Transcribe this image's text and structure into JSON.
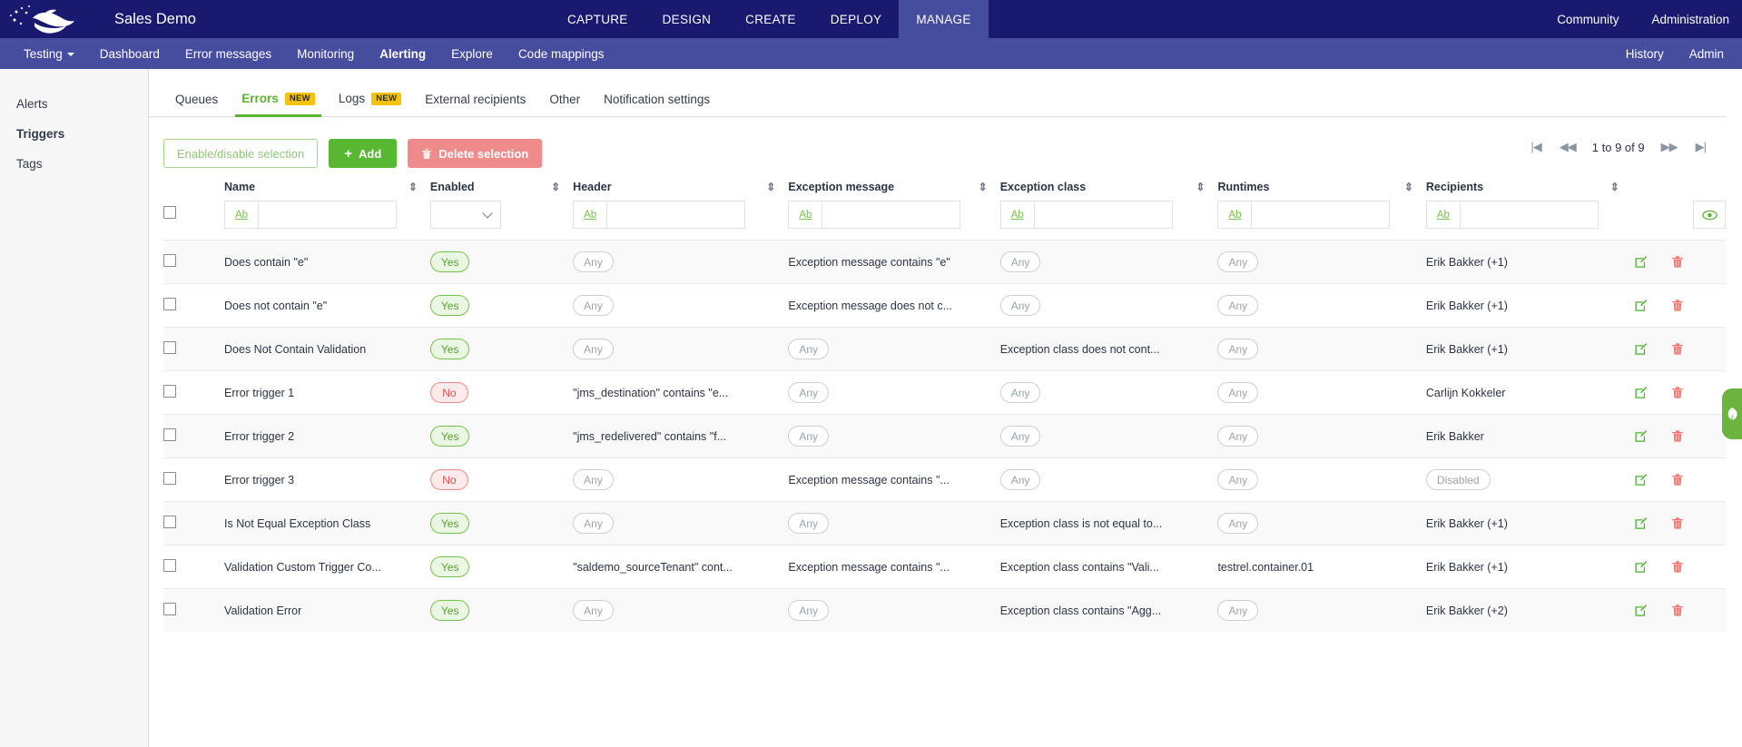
{
  "header": {
    "brand_title": "Sales Demo",
    "logo_icon": "whale-logo-icon",
    "center_nav": [
      {
        "label": "CAPTURE",
        "active": false
      },
      {
        "label": "DESIGN",
        "active": false
      },
      {
        "label": "CREATE",
        "active": false
      },
      {
        "label": "DEPLOY",
        "active": false
      },
      {
        "label": "MANAGE",
        "active": true
      }
    ],
    "right_nav": [
      {
        "label": "Community"
      },
      {
        "label": "Administration"
      }
    ],
    "accent_bg": "#191970",
    "active_tab_bg": "#464c9e"
  },
  "subnav": {
    "items": [
      {
        "label": "Testing",
        "has_caret": true,
        "bold": false
      },
      {
        "label": "Dashboard",
        "has_caret": false,
        "bold": false
      },
      {
        "label": "Error messages",
        "has_caret": false,
        "bold": false
      },
      {
        "label": "Monitoring",
        "has_caret": false,
        "bold": false
      },
      {
        "label": "Alerting",
        "has_caret": false,
        "bold": true
      },
      {
        "label": "Explore",
        "has_caret": false,
        "bold": false
      },
      {
        "label": "Code mappings",
        "has_caret": false,
        "bold": false
      }
    ],
    "right_items": [
      {
        "label": "History"
      },
      {
        "label": "Admin"
      }
    ]
  },
  "sidebar": {
    "items": [
      {
        "label": "Alerts",
        "active": false
      },
      {
        "label": "Triggers",
        "active": true
      },
      {
        "label": "Tags",
        "active": false
      }
    ]
  },
  "tabs": [
    {
      "label": "Queues",
      "badge": null,
      "active": false
    },
    {
      "label": "Errors",
      "badge": "NEW",
      "active": true
    },
    {
      "label": "Logs",
      "badge": "NEW",
      "active": false
    },
    {
      "label": "External recipients",
      "badge": null,
      "active": false
    },
    {
      "label": "Other",
      "badge": null,
      "active": false
    },
    {
      "label": "Notification settings",
      "badge": null,
      "active": false
    }
  ],
  "toolbar": {
    "enable_disable_label": "Enable/disable selection",
    "add_label": "Add",
    "add_icon": "plus-icon",
    "delete_label": "Delete selection",
    "delete_icon": "trash-icon"
  },
  "pagination": {
    "first_icon": "first-page-icon",
    "prev_icon": "previous-page-icon",
    "range_label": "1 to 9 of 9",
    "next_icon": "next-page-icon",
    "last_icon": "last-page-icon"
  },
  "table": {
    "columns": [
      {
        "key": "name",
        "label": "Name",
        "sortable": true
      },
      {
        "key": "enabled",
        "label": "Enabled",
        "sortable": true
      },
      {
        "key": "header",
        "label": "Header",
        "sortable": true
      },
      {
        "key": "exception_message",
        "label": "Exception message",
        "sortable": true
      },
      {
        "key": "exception_class",
        "label": "Exception class",
        "sortable": true
      },
      {
        "key": "runtimes",
        "label": "Runtimes",
        "sortable": true
      },
      {
        "key": "recipients",
        "label": "Recipients",
        "sortable": true
      }
    ],
    "filter_row": {
      "ab_label": "Ab",
      "name_value": "",
      "header_value": "",
      "exception_message_value": "",
      "exception_class_value": "",
      "runtimes_value": "",
      "recipients_value": "",
      "enabled_select_value": "",
      "eye_icon": "eye-icon",
      "select_all_checkbox": false
    },
    "rows": [
      {
        "name": "Does contain \"e\"",
        "enabled": {
          "text": "Yes",
          "style": "yes"
        },
        "header": {
          "text": "Any",
          "style": "any"
        },
        "exception_message": {
          "text": "Exception message contains \"e\"",
          "style": "text"
        },
        "exception_class": {
          "text": "Any",
          "style": "any"
        },
        "runtimes": {
          "text": "Any",
          "style": "any"
        },
        "recipients": "Erik Bakker (+1)"
      },
      {
        "name": "Does not contain \"e\"",
        "enabled": {
          "text": "Yes",
          "style": "yes"
        },
        "header": {
          "text": "Any",
          "style": "any"
        },
        "exception_message": {
          "text": "Exception message does not c...",
          "style": "text"
        },
        "exception_class": {
          "text": "Any",
          "style": "any"
        },
        "runtimes": {
          "text": "Any",
          "style": "any"
        },
        "recipients": "Erik Bakker (+1)"
      },
      {
        "name": "Does Not Contain Validation",
        "enabled": {
          "text": "Yes",
          "style": "yes"
        },
        "header": {
          "text": "Any",
          "style": "any"
        },
        "exception_message": {
          "text": "Any",
          "style": "any"
        },
        "exception_class": {
          "text": "Exception class does not cont...",
          "style": "text"
        },
        "runtimes": {
          "text": "Any",
          "style": "any"
        },
        "recipients": "Erik Bakker (+1)"
      },
      {
        "name": "Error trigger 1",
        "enabled": {
          "text": "No",
          "style": "no"
        },
        "header": {
          "text": "\"jms_destination\" contains \"e...",
          "style": "text"
        },
        "exception_message": {
          "text": "Any",
          "style": "any"
        },
        "exception_class": {
          "text": "Any",
          "style": "any"
        },
        "runtimes": {
          "text": "Any",
          "style": "any"
        },
        "recipients": "Carlijn Kokkeler"
      },
      {
        "name": "Error trigger 2",
        "enabled": {
          "text": "Yes",
          "style": "yes"
        },
        "header": {
          "text": "\"jms_redelivered\" contains \"f...",
          "style": "text"
        },
        "exception_message": {
          "text": "Any",
          "style": "any"
        },
        "exception_class": {
          "text": "Any",
          "style": "any"
        },
        "runtimes": {
          "text": "Any",
          "style": "any"
        },
        "recipients": "Erik Bakker"
      },
      {
        "name": "Error trigger 3",
        "enabled": {
          "text": "No",
          "style": "no"
        },
        "header": {
          "text": "Any",
          "style": "any"
        },
        "exception_message": {
          "text": "Exception message contains \"...",
          "style": "text"
        },
        "exception_class": {
          "text": "Any",
          "style": "any"
        },
        "runtimes": {
          "text": "Any",
          "style": "any"
        },
        "recipients_pill": {
          "text": "Disabled",
          "style": "disabled"
        }
      },
      {
        "name": "Is Not Equal Exception Class",
        "enabled": {
          "text": "Yes",
          "style": "yes"
        },
        "header": {
          "text": "Any",
          "style": "any"
        },
        "exception_message": {
          "text": "Any",
          "style": "any"
        },
        "exception_class": {
          "text": "Exception class is not equal to...",
          "style": "text"
        },
        "runtimes": {
          "text": "Any",
          "style": "any"
        },
        "recipients": "Erik Bakker (+1)"
      },
      {
        "name": "Validation Custom Trigger Co...",
        "enabled": {
          "text": "Yes",
          "style": "yes"
        },
        "header": {
          "text": "\"saldemo_sourceTenant\" cont...",
          "style": "text"
        },
        "exception_message": {
          "text": "Exception message contains \"...",
          "style": "text"
        },
        "exception_class": {
          "text": "Exception class contains \"Vali...",
          "style": "text"
        },
        "runtimes": {
          "text": "testrel.container.01",
          "style": "text"
        },
        "recipients": "Erik Bakker (+1)"
      },
      {
        "name": "Validation Error",
        "enabled": {
          "text": "Yes",
          "style": "yes"
        },
        "header": {
          "text": "Any",
          "style": "any"
        },
        "exception_message": {
          "text": "Any",
          "style": "any"
        },
        "exception_class": {
          "text": "Exception class contains \"Agg...",
          "style": "text"
        },
        "runtimes": {
          "text": "Any",
          "style": "any"
        },
        "recipients": "Erik Bakker (+2)"
      }
    ],
    "row_actions": {
      "edit_icon": "edit-icon",
      "delete_icon": "trash-icon"
    }
  },
  "edge_widget": {
    "icon": "leaf-help-icon",
    "color": "#6cb33f"
  },
  "colors": {
    "brand_dark": "#191970",
    "brand_mid": "#464c9e",
    "green": "#58b832",
    "red": "#ef8b8b",
    "yellow": "#f4c40c"
  }
}
